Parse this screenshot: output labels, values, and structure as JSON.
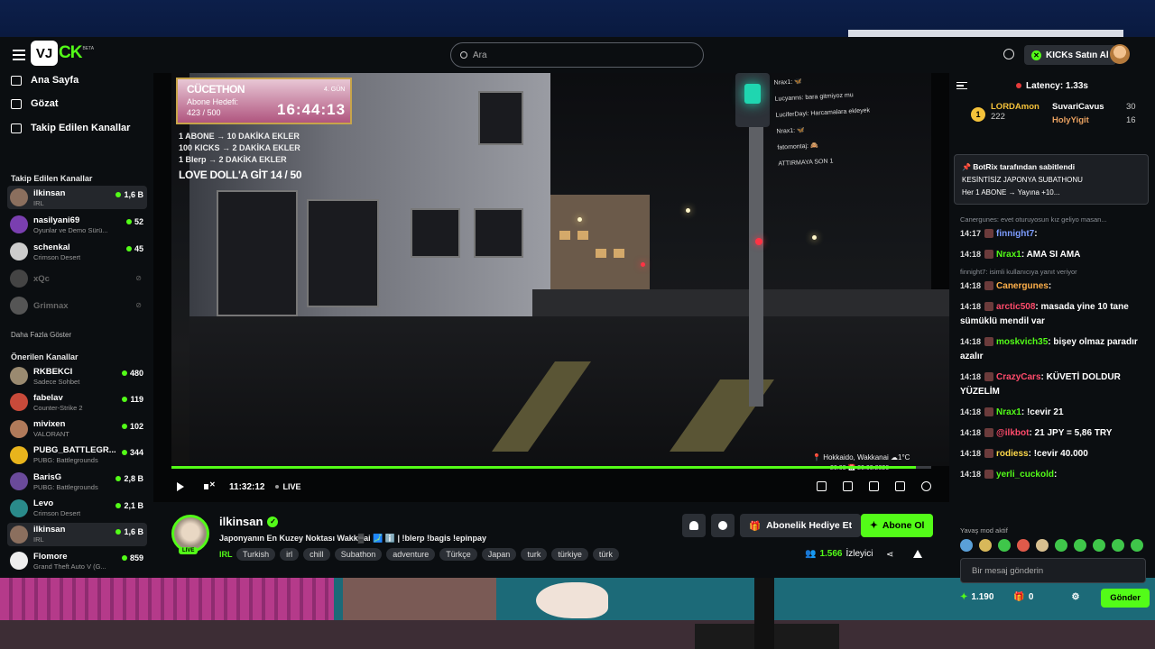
{
  "search": {
    "placeholder": "Ara"
  },
  "header": {
    "logo_box": "VJ",
    "logo_text": "CK",
    "beta": "BETA",
    "buy_kicks": "KICKs Satın Al"
  },
  "nav": [
    {
      "label": "Ana Sayfa",
      "icon": "home-icon"
    },
    {
      "label": "Gözat",
      "icon": "browse-icon"
    },
    {
      "label": "Takip Edilen Kanallar",
      "icon": "heart-icon"
    }
  ],
  "followed_heading": "Takip Edilen Kanallar",
  "followed": [
    {
      "name": "ilkinsan",
      "category": "IRL",
      "viewers": "1,6 B",
      "color": "#8b6f5e",
      "active": true
    },
    {
      "name": "nasilyani69",
      "category": "Oyunlar ve Demo Sürü...",
      "viewers": "52",
      "color": "#7a3fb0"
    },
    {
      "name": "schenkal",
      "category": "Crimson Desert",
      "viewers": "45",
      "color": "#cccccc"
    },
    {
      "name": "xQc",
      "category": "",
      "viewers": "",
      "color": "#444444",
      "offline": true
    },
    {
      "name": "Grimnax",
      "category": "",
      "viewers": "",
      "color": "#555555",
      "offline": true
    }
  ],
  "show_more": "Daha Fazla Göster",
  "recommended_heading": "Önerilen Kanallar",
  "recommended": [
    {
      "name": "RKBEKCI",
      "category": "Sadece Sohbet",
      "viewers": "480",
      "color": "#9a8a70"
    },
    {
      "name": "fabelav",
      "category": "Counter-Strike 2",
      "viewers": "119",
      "color": "#c84a3a"
    },
    {
      "name": "mivixen",
      "category": "VALORANT",
      "viewers": "102",
      "color": "#b07a5a"
    },
    {
      "name": "PUBG_BATTLEGR...",
      "category": "PUBG: Battlegrounds",
      "viewers": "344",
      "color": "#e8b41c"
    },
    {
      "name": "BarisG",
      "category": "PUBG: Battlegrounds",
      "viewers": "2,8 B",
      "color": "#6a4a9a"
    },
    {
      "name": "Levo",
      "category": "Crimson Desert",
      "viewers": "2,1 B",
      "color": "#2a8a8a"
    },
    {
      "name": "ilkinsan",
      "category": "IRL",
      "viewers": "1,6 B",
      "color": "#8b6f5e",
      "active": true
    },
    {
      "name": "Flomore",
      "category": "Grand Theft Auto V (G...",
      "viewers": "859",
      "color": "#eeeeee"
    }
  ],
  "overlay": {
    "title": "CÜCETHON",
    "goal": "Abone Hedefi:",
    "count": "423 / 500",
    "day": "4. GÜN",
    "timer": "16:44:13",
    "rules": [
      "1 ABONE → 10 DAKİKA EKLER",
      "100 KICKS → 2 DAKİKA EKLER",
      "1 Blerp → 2 DAKİKA EKLER"
    ],
    "love": "LOVE DOLL'A GİT  14 / 50",
    "chat": [
      "Nrax1: 🦋",
      "Lucyanns: bara gitmiyoz mu",
      "LuciferDayi: Harcamalara ekleyek",
      "Nrax1: 🦋",
      "fatomontaj: 🙈",
      "ATTIRMAYA SON 1"
    ],
    "location": "Hokkaido, Wakkanai ☁1°C",
    "date": "20:03 📅 20.03.2026"
  },
  "player": {
    "time": "11:32:12",
    "live": "LIVE",
    "progress": 0.98
  },
  "stream": {
    "streamer": "ilkinsan",
    "live_badge": "LIVE",
    "title": "Japonyanın En Kuzey Noktası Wakk▒ai 🗾 ℹ️ | !blerp !bagis !epinpay",
    "category": "IRL",
    "tags": [
      "Turkish",
      "irl",
      "chill",
      "Subathon",
      "adventure",
      "Türkçe",
      "Japan",
      "turk",
      "türkiye",
      "türk"
    ],
    "gift_label": "Abonelik Hediye Et",
    "subscribe_label": "Abone Ol",
    "viewers": "1.566",
    "viewers_label": "İzleyici"
  },
  "chat": {
    "latency": "Latency: 1.33s",
    "leaders": [
      {
        "name": "LORDAmon",
        "value": "222",
        "color": "#f5c23a"
      },
      {
        "name": "SuvariCavus",
        "value": "30",
        "color": "#d9d9d9"
      },
      {
        "name": "HolyYigit",
        "value": "16",
        "color": "#e8a060"
      }
    ],
    "pinned_by": "BotRix tarafından sabitlendi",
    "pinned_line1": "KESİNTİSİZ JAPONYA SUBATHONU",
    "pinned_line2": "Her 1 ABONE → Yayına +10...",
    "messages": [
      {
        "reply": "Canergunes: evet oturuyosun kız geliyo masan...",
        "time": "14:17",
        "user": "finnight7",
        "color": "#7c9cff",
        "text": ":"
      },
      {
        "reply": "",
        "time": "14:18",
        "user": "Nrax1",
        "color": "#53fc18",
        "text": ": AMA SI   AMA"
      },
      {
        "reply": "finnight7: isimli kullanıcıya yanıt veriyor",
        "time": "14:18",
        "user": "Canergunes",
        "color": "#ffb04a",
        "text": ":"
      },
      {
        "reply": "",
        "time": "14:18",
        "user": "arctic508",
        "color": "#ff4b6b",
        "text": ": masada yine 10 tane sümüklü mendil var"
      },
      {
        "reply": "",
        "time": "14:18",
        "user": "moskvich35",
        "color": "#53fc18",
        "text": ": bişey olmaz paradır azalır"
      },
      {
        "reply": "",
        "time": "14:18",
        "user": "CrazyCars",
        "color": "#ff4b6b",
        "text": ": KÜVETİ DOLDUR YÜZELİM"
      },
      {
        "reply": "",
        "time": "14:18",
        "user": "Nrax1",
        "color": "#53fc18",
        "text": ": !cevir 21"
      },
      {
        "reply": "",
        "time": "14:18",
        "user": "@ilkbot",
        "color": "#ff4b6b",
        "text": ": 21 JPY = 5,86 TRY"
      },
      {
        "reply": "",
        "time": "14:18",
        "user": "rodiess",
        "color": "#ffd84a",
        "text": ": !cevir 40.000"
      },
      {
        "reply": "",
        "time": "14:18",
        "user": "yerli_cuckold",
        "color": "#53fc18",
        "text": ":"
      }
    ],
    "slow_mode": "Yavaş mod aktif",
    "input_placeholder": "Bir mesaj gönderin",
    "kicks": "1.190",
    "gifts": "0",
    "send": "Gönder"
  }
}
